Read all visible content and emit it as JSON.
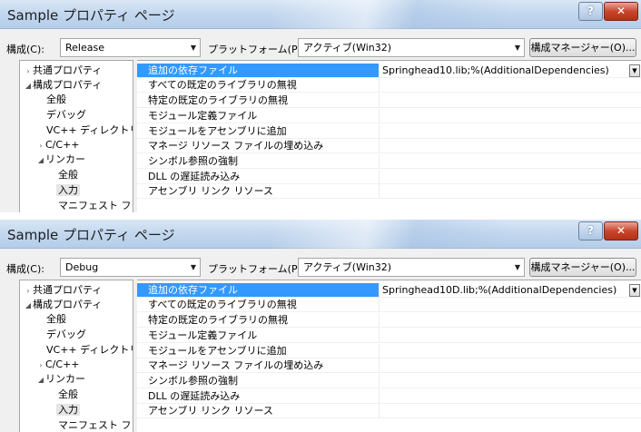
{
  "panels": [
    {
      "title": "Sample プロパティ ページ",
      "config_label": "構成(C):",
      "config_value": "Release",
      "platform_label": "プラットフォーム(P):",
      "platform_value": "アクティブ(Win32)",
      "config_manager_label": "構成マネージャー(O)...",
      "help_label": "?",
      "close_label": "✕",
      "tree": [
        {
          "label": "共通プロパティ",
          "toggle": "›",
          "indent": 0
        },
        {
          "label": "構成プロパティ",
          "toggle": "◢",
          "indent": 0
        },
        {
          "label": "全般",
          "toggle": "",
          "indent": 2
        },
        {
          "label": "デバッグ",
          "toggle": "",
          "indent": 2
        },
        {
          "label": "VC++ ディレクトリ",
          "toggle": "",
          "indent": 2
        },
        {
          "label": "C/C++",
          "toggle": "›",
          "indent": 1
        },
        {
          "label": "リンカー",
          "toggle": "◢",
          "indent": 1
        },
        {
          "label": "全般",
          "toggle": "",
          "indent": 3
        },
        {
          "label": "入力",
          "toggle": "",
          "indent": 3,
          "selected": true
        },
        {
          "label": "マニフェスト ファ",
          "toggle": "",
          "indent": 3
        }
      ],
      "properties": [
        {
          "name": "追加の依存ファイル",
          "value": "Springhead10.lib;%(AdditionalDependencies)",
          "selected": true
        },
        {
          "name": "すべての既定のライブラリの無視",
          "value": ""
        },
        {
          "name": "特定の既定のライブラリの無視",
          "value": ""
        },
        {
          "name": "モジュール定義ファイル",
          "value": ""
        },
        {
          "name": "モジュールをアセンブリに追加",
          "value": ""
        },
        {
          "name": "マネージ リソース ファイルの埋め込み",
          "value": ""
        },
        {
          "name": "シンボル参照の強制",
          "value": ""
        },
        {
          "name": "DLL の遅延読み込み",
          "value": ""
        },
        {
          "name": "アセンブリ リンク リソース",
          "value": ""
        }
      ]
    },
    {
      "title": "Sample プロパティ ページ",
      "config_label": "構成(C):",
      "config_value": "Debug",
      "platform_label": "プラットフォーム(P):",
      "platform_value": "アクティブ(Win32)",
      "config_manager_label": "構成マネージャー(O)...",
      "help_label": "?",
      "close_label": "✕",
      "tree": [
        {
          "label": "共通プロパティ",
          "toggle": "›",
          "indent": 0
        },
        {
          "label": "構成プロパティ",
          "toggle": "◢",
          "indent": 0
        },
        {
          "label": "全般",
          "toggle": "",
          "indent": 2
        },
        {
          "label": "デバッグ",
          "toggle": "",
          "indent": 2
        },
        {
          "label": "VC++ ディレクトリ",
          "toggle": "",
          "indent": 2
        },
        {
          "label": "C/C++",
          "toggle": "›",
          "indent": 1
        },
        {
          "label": "リンカー",
          "toggle": "◢",
          "indent": 1
        },
        {
          "label": "全般",
          "toggle": "",
          "indent": 3
        },
        {
          "label": "入力",
          "toggle": "",
          "indent": 3,
          "selected": true
        },
        {
          "label": "マニフェスト ファ",
          "toggle": "",
          "indent": 3
        }
      ],
      "properties": [
        {
          "name": "追加の依存ファイル",
          "value": "Springhead10D.lib;%(AdditionalDependencies)",
          "selected": true
        },
        {
          "name": "すべての既定のライブラリの無視",
          "value": ""
        },
        {
          "name": "特定の既定のライブラリの無視",
          "value": ""
        },
        {
          "name": "モジュール定義ファイル",
          "value": ""
        },
        {
          "name": "モジュールをアセンブリに追加",
          "value": ""
        },
        {
          "name": "マネージ リソース ファイルの埋め込み",
          "value": ""
        },
        {
          "name": "シンボル参照の強制",
          "value": ""
        },
        {
          "name": "DLL の遅延読み込み",
          "value": ""
        },
        {
          "name": "アセンブリ リンク リソース",
          "value": ""
        }
      ]
    }
  ]
}
